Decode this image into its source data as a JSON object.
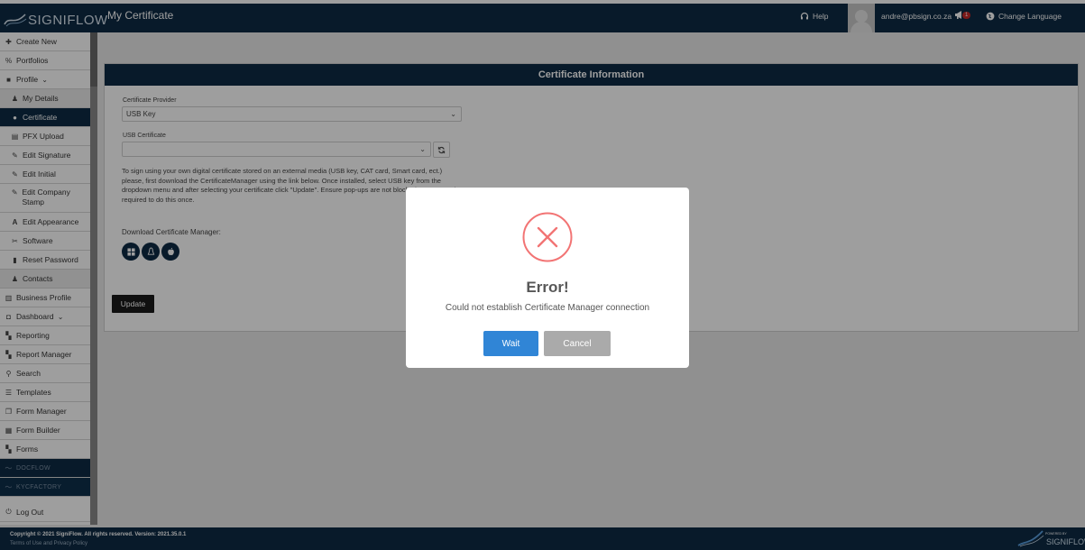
{
  "header": {
    "brand": "SIGNIFLOW",
    "title": "My Certificate",
    "help_label": "Help",
    "user_email": "andre@pbsign.co.za",
    "notification_count": "1",
    "language_label": "Change Language"
  },
  "sidebar": {
    "create_new": "Create New",
    "portfolios": "Portfolios",
    "profile": "Profile",
    "my_details": "My Details",
    "certificate": "Certificate",
    "pfx_upload": "PFX Upload",
    "edit_signature": "Edit Signature",
    "edit_initial": "Edit Initial",
    "edit_company_stamp": "Edit Company Stamp",
    "edit_appearance": "Edit Appearance",
    "software": "Software",
    "reset_password": "Reset Password",
    "contacts": "Contacts",
    "business_profile": "Business Profile",
    "dashboard": "Dashboard",
    "reporting": "Reporting",
    "report_manager": "Report Manager",
    "search": "Search",
    "templates": "Templates",
    "form_manager": "Form Manager",
    "form_builder": "Form Builder",
    "forms": "Forms",
    "docflow": "DOCFLOW",
    "kycfactory": "KYCFACTORY",
    "log_out": "Log Out"
  },
  "panel": {
    "title": "Certificate Information",
    "provider_label": "Certificate Provider",
    "provider_value": "USB Key",
    "usb_cert_label": "USB Certificate",
    "usb_cert_value": "",
    "info_text": "To sign using your own digital certificate stored on an external media (USB key, CAT card, Smart card, ect.) please, first download the CertificateManager using the link below. Once installed, select USB key from the dropdown menu and after selecting your certificate click \"Update\". Ensure pop-ups are not blocked - you are only required to do this once.",
    "download_label": "Download Certificate Manager:",
    "update_label": "Update"
  },
  "modal": {
    "title": "Error!",
    "message": "Could not establish Certificate Manager connection",
    "wait_label": "Wait",
    "cancel_label": "Cancel"
  },
  "footer": {
    "copyright": "Copyright © 2021 SigniFlow. All rights reserved. Version: 2021.35.0.1",
    "terms": "Terms of Use and Privacy Policy",
    "powered_by": "POWERED BY",
    "logo_name": "SIGNIFLOW"
  },
  "colors": {
    "navy": "#0d2b45",
    "primary_button": "#3085d6",
    "cancel_button": "#aaaaaa",
    "error_icon": "#f27474"
  }
}
